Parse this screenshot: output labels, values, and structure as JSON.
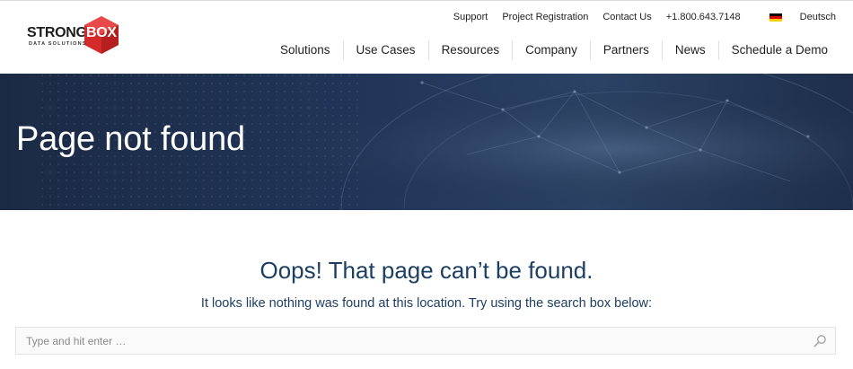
{
  "brand": {
    "word1": "STRONG",
    "word2": "BOX",
    "tagline": "DATA SOLUTIONS",
    "accent": "#d42a2a"
  },
  "topbar": {
    "support": "Support",
    "project_registration": "Project Registration",
    "contact_us": "Contact Us",
    "phone": "+1.800.643.7148",
    "language": "Deutsch",
    "language_icon": "german-flag-icon"
  },
  "nav": {
    "items": [
      "Solutions",
      "Use Cases",
      "Resources",
      "Company",
      "Partners",
      "News",
      "Schedule a Demo"
    ]
  },
  "hero": {
    "title": "Page not found"
  },
  "content": {
    "heading": "Oops! That page can’t be found.",
    "message": "It looks like nothing was found at this location. Try using the search box below:"
  },
  "search": {
    "placeholder": "Type and hit enter …",
    "value": "",
    "icon": "search-icon"
  }
}
